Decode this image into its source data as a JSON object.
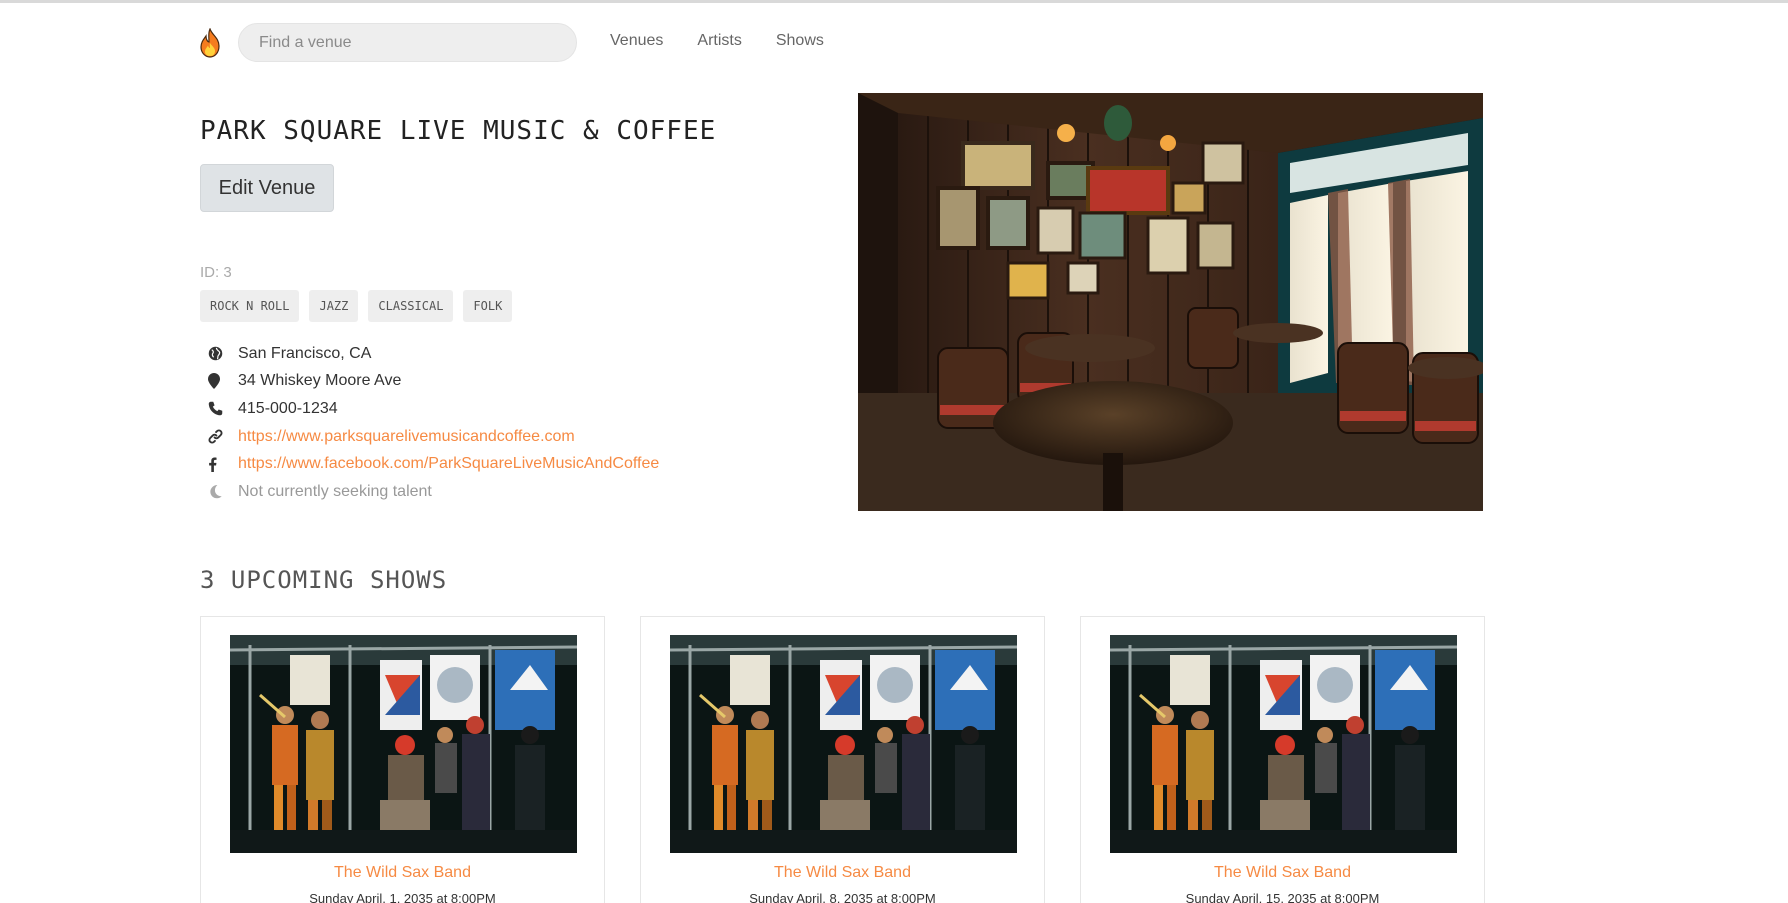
{
  "navbar": {
    "search_placeholder": "Find a venue",
    "links": [
      "Venues",
      "Artists",
      "Shows"
    ]
  },
  "venue": {
    "name": "PARK SQUARE LIVE MUSIC & COFFEE",
    "edit_label": "Edit Venue",
    "id_text": "ID: 3",
    "genres": [
      "ROCK N ROLL",
      "JAZZ",
      "CLASSICAL",
      "FOLK"
    ],
    "location": "San Francisco, CA",
    "address": "34 Whiskey Moore Ave",
    "phone": "415-000-1234",
    "website": "https://www.parksquarelivemusicandcoffee.com",
    "facebook": "https://www.facebook.com/ParkSquareLiveMusicAndCoffee",
    "seeking": "Not currently seeking talent"
  },
  "upcoming": {
    "title": "3 UPCOMING SHOWS",
    "shows": [
      {
        "artist": "The Wild Sax Band",
        "time": "Sunday April, 1, 2035 at 8:00PM"
      },
      {
        "artist": "The Wild Sax Band",
        "time": "Sunday April, 8, 2035 at 8:00PM"
      },
      {
        "artist": "The Wild Sax Band",
        "time": "Sunday April, 15, 2035 at 8:00PM"
      }
    ]
  },
  "icons": {
    "brand": "flame-icon",
    "location": "globe-icon",
    "address": "map-pin-icon",
    "phone": "phone-icon",
    "website": "link-icon",
    "facebook": "facebook-icon",
    "seeking": "moon-icon"
  },
  "colors": {
    "accent": "#f68a43",
    "muted": "#999999",
    "button_bg": "#dfe3e6"
  }
}
